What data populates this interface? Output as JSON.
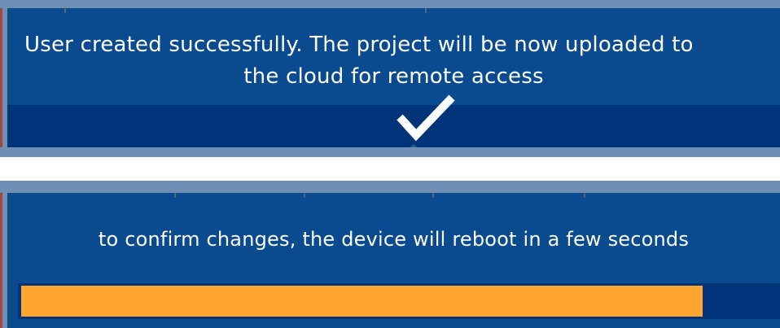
{
  "success_dialog": {
    "message_line1": "User created successfully. The project will be now uploaded to",
    "message_line2": "the cloud for remote access",
    "icon": "checkmark-icon"
  },
  "reboot_dialog": {
    "message": "to confirm changes, the device will reboot in a few seconds",
    "progress_fraction": 0.898
  },
  "colors": {
    "panel": "#0a4a8e",
    "band": "#003478",
    "frame": "#6f8fb4",
    "progress": "#ffa530",
    "text": "#ffffff"
  }
}
